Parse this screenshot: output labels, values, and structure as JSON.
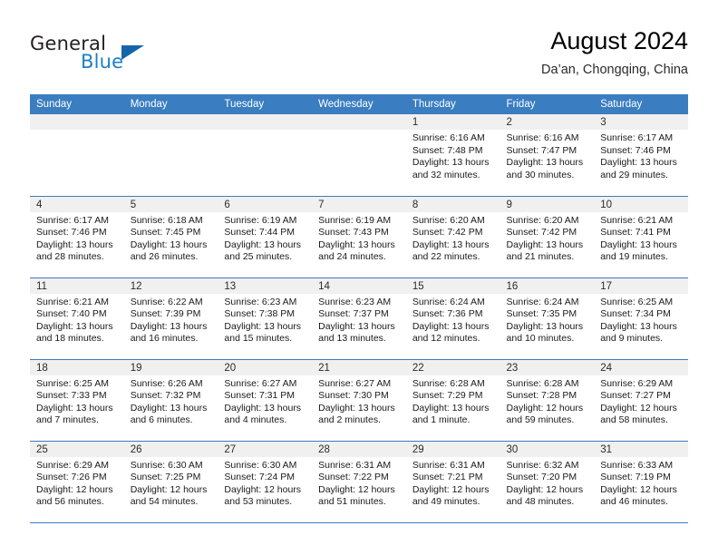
{
  "brand": {
    "name_part1": "General",
    "name_part2": "Blue",
    "logo_icon": "triangle-logo-icon"
  },
  "header": {
    "title": "August 2024",
    "subtitle": "Da’an, Chongqing, China"
  },
  "calendar": {
    "weekday_headers": [
      "Sunday",
      "Monday",
      "Tuesday",
      "Wednesday",
      "Thursday",
      "Friday",
      "Saturday"
    ],
    "accent_color": "#3a7dc0",
    "daynum_band_color": "#f0f0f0",
    "weeks": [
      [
        {
          "day": "",
          "lines": []
        },
        {
          "day": "",
          "lines": []
        },
        {
          "day": "",
          "lines": []
        },
        {
          "day": "",
          "lines": []
        },
        {
          "day": "1",
          "lines": [
            "Sunrise: 6:16 AM",
            "Sunset: 7:48 PM",
            "Daylight: 13 hours",
            "and 32 minutes."
          ]
        },
        {
          "day": "2",
          "lines": [
            "Sunrise: 6:16 AM",
            "Sunset: 7:47 PM",
            "Daylight: 13 hours",
            "and 30 minutes."
          ]
        },
        {
          "day": "3",
          "lines": [
            "Sunrise: 6:17 AM",
            "Sunset: 7:46 PM",
            "Daylight: 13 hours",
            "and 29 minutes."
          ]
        }
      ],
      [
        {
          "day": "4",
          "lines": [
            "Sunrise: 6:17 AM",
            "Sunset: 7:46 PM",
            "Daylight: 13 hours",
            "and 28 minutes."
          ]
        },
        {
          "day": "5",
          "lines": [
            "Sunrise: 6:18 AM",
            "Sunset: 7:45 PM",
            "Daylight: 13 hours",
            "and 26 minutes."
          ]
        },
        {
          "day": "6",
          "lines": [
            "Sunrise: 6:19 AM",
            "Sunset: 7:44 PM",
            "Daylight: 13 hours",
            "and 25 minutes."
          ]
        },
        {
          "day": "7",
          "lines": [
            "Sunrise: 6:19 AM",
            "Sunset: 7:43 PM",
            "Daylight: 13 hours",
            "and 24 minutes."
          ]
        },
        {
          "day": "8",
          "lines": [
            "Sunrise: 6:20 AM",
            "Sunset: 7:42 PM",
            "Daylight: 13 hours",
            "and 22 minutes."
          ]
        },
        {
          "day": "9",
          "lines": [
            "Sunrise: 6:20 AM",
            "Sunset: 7:42 PM",
            "Daylight: 13 hours",
            "and 21 minutes."
          ]
        },
        {
          "day": "10",
          "lines": [
            "Sunrise: 6:21 AM",
            "Sunset: 7:41 PM",
            "Daylight: 13 hours",
            "and 19 minutes."
          ]
        }
      ],
      [
        {
          "day": "11",
          "lines": [
            "Sunrise: 6:21 AM",
            "Sunset: 7:40 PM",
            "Daylight: 13 hours",
            "and 18 minutes."
          ]
        },
        {
          "day": "12",
          "lines": [
            "Sunrise: 6:22 AM",
            "Sunset: 7:39 PM",
            "Daylight: 13 hours",
            "and 16 minutes."
          ]
        },
        {
          "day": "13",
          "lines": [
            "Sunrise: 6:23 AM",
            "Sunset: 7:38 PM",
            "Daylight: 13 hours",
            "and 15 minutes."
          ]
        },
        {
          "day": "14",
          "lines": [
            "Sunrise: 6:23 AM",
            "Sunset: 7:37 PM",
            "Daylight: 13 hours",
            "and 13 minutes."
          ]
        },
        {
          "day": "15",
          "lines": [
            "Sunrise: 6:24 AM",
            "Sunset: 7:36 PM",
            "Daylight: 13 hours",
            "and 12 minutes."
          ]
        },
        {
          "day": "16",
          "lines": [
            "Sunrise: 6:24 AM",
            "Sunset: 7:35 PM",
            "Daylight: 13 hours",
            "and 10 minutes."
          ]
        },
        {
          "day": "17",
          "lines": [
            "Sunrise: 6:25 AM",
            "Sunset: 7:34 PM",
            "Daylight: 13 hours",
            "and 9 minutes."
          ]
        }
      ],
      [
        {
          "day": "18",
          "lines": [
            "Sunrise: 6:25 AM",
            "Sunset: 7:33 PM",
            "Daylight: 13 hours",
            "and 7 minutes."
          ]
        },
        {
          "day": "19",
          "lines": [
            "Sunrise: 6:26 AM",
            "Sunset: 7:32 PM",
            "Daylight: 13 hours",
            "and 6 minutes."
          ]
        },
        {
          "day": "20",
          "lines": [
            "Sunrise: 6:27 AM",
            "Sunset: 7:31 PM",
            "Daylight: 13 hours",
            "and 4 minutes."
          ]
        },
        {
          "day": "21",
          "lines": [
            "Sunrise: 6:27 AM",
            "Sunset: 7:30 PM",
            "Daylight: 13 hours",
            "and 2 minutes."
          ]
        },
        {
          "day": "22",
          "lines": [
            "Sunrise: 6:28 AM",
            "Sunset: 7:29 PM",
            "Daylight: 13 hours",
            "and 1 minute."
          ]
        },
        {
          "day": "23",
          "lines": [
            "Sunrise: 6:28 AM",
            "Sunset: 7:28 PM",
            "Daylight: 12 hours",
            "and 59 minutes."
          ]
        },
        {
          "day": "24",
          "lines": [
            "Sunrise: 6:29 AM",
            "Sunset: 7:27 PM",
            "Daylight: 12 hours",
            "and 58 minutes."
          ]
        }
      ],
      [
        {
          "day": "25",
          "lines": [
            "Sunrise: 6:29 AM",
            "Sunset: 7:26 PM",
            "Daylight: 12 hours",
            "and 56 minutes."
          ]
        },
        {
          "day": "26",
          "lines": [
            "Sunrise: 6:30 AM",
            "Sunset: 7:25 PM",
            "Daylight: 12 hours",
            "and 54 minutes."
          ]
        },
        {
          "day": "27",
          "lines": [
            "Sunrise: 6:30 AM",
            "Sunset: 7:24 PM",
            "Daylight: 12 hours",
            "and 53 minutes."
          ]
        },
        {
          "day": "28",
          "lines": [
            "Sunrise: 6:31 AM",
            "Sunset: 7:22 PM",
            "Daylight: 12 hours",
            "and 51 minutes."
          ]
        },
        {
          "day": "29",
          "lines": [
            "Sunrise: 6:31 AM",
            "Sunset: 7:21 PM",
            "Daylight: 12 hours",
            "and 49 minutes."
          ]
        },
        {
          "day": "30",
          "lines": [
            "Sunrise: 6:32 AM",
            "Sunset: 7:20 PM",
            "Daylight: 12 hours",
            "and 48 minutes."
          ]
        },
        {
          "day": "31",
          "lines": [
            "Sunrise: 6:33 AM",
            "Sunset: 7:19 PM",
            "Daylight: 12 hours",
            "and 46 minutes."
          ]
        }
      ]
    ]
  }
}
